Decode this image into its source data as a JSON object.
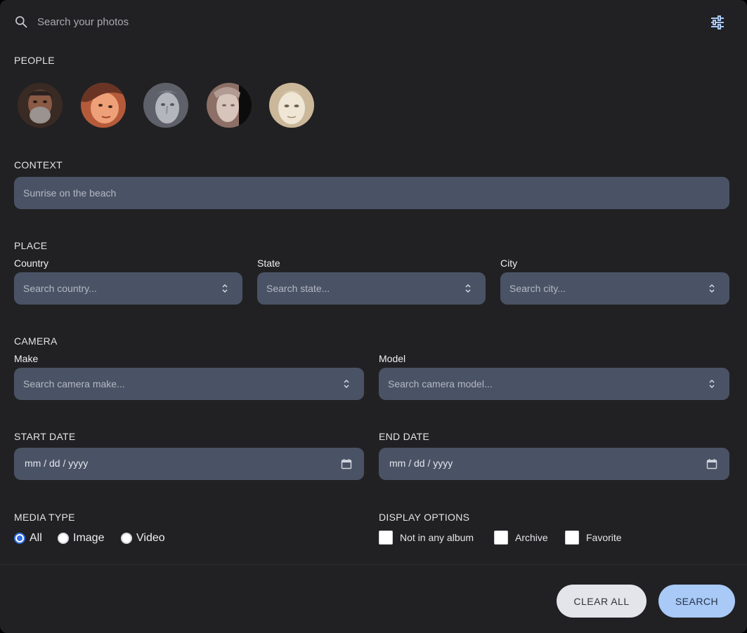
{
  "search": {
    "placeholder": "Search your photos"
  },
  "people": {
    "label": "PEOPLE",
    "avatars": [
      {
        "name": "person-1",
        "tone": "#6b4a3c"
      },
      {
        "name": "person-2",
        "tone": "#d88a5c"
      },
      {
        "name": "person-3",
        "tone": "#8f8f97"
      },
      {
        "name": "person-4",
        "tone": "#a48b82"
      },
      {
        "name": "person-5",
        "tone": "#e7dcc6"
      }
    ]
  },
  "context": {
    "label": "CONTEXT",
    "placeholder": "Sunrise on the beach"
  },
  "place": {
    "label": "PLACE",
    "country": {
      "label": "Country",
      "placeholder": "Search country..."
    },
    "state": {
      "label": "State",
      "placeholder": "Search state..."
    },
    "city": {
      "label": "City",
      "placeholder": "Search city..."
    }
  },
  "camera": {
    "label": "CAMERA",
    "make": {
      "label": "Make",
      "placeholder": "Search camera make..."
    },
    "model": {
      "label": "Model",
      "placeholder": "Search camera model..."
    }
  },
  "start_date": {
    "label": "START DATE",
    "value": "mm / dd / yyyy"
  },
  "end_date": {
    "label": "END DATE",
    "value": "mm / dd / yyyy"
  },
  "media_type": {
    "label": "MEDIA TYPE",
    "options": [
      "All",
      "Image",
      "Video"
    ],
    "selected": "All"
  },
  "display_options": {
    "label": "DISPLAY OPTIONS",
    "options": [
      "Not in any album",
      "Archive",
      "Favorite"
    ]
  },
  "buttons": {
    "clear": "CLEAR ALL",
    "search": "SEARCH"
  },
  "colors": {
    "panel": "#212123",
    "field": "#4a5365",
    "accent": "#a9c9f7",
    "radio": "#2f6fe4"
  }
}
